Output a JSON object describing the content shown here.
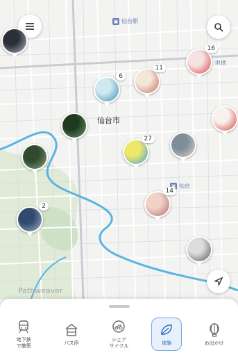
{
  "map": {
    "city_label": "仙台市",
    "watermark": "Pathweaver",
    "poi_top": "仙台駅",
    "poi_mid": "仙台",
    "poi_right": "IR他"
  },
  "pins": [
    {
      "id": "pin-a",
      "count": "6",
      "colors": [
        "#cfe7ef",
        "#3c8fb0"
      ]
    },
    {
      "id": "pin-b",
      "count": "11",
      "colors": [
        "#f2e7d8",
        "#c96a61"
      ]
    },
    {
      "id": "pin-c",
      "count": "16",
      "colors": [
        "#f4e3e0",
        "#d9424a"
      ]
    },
    {
      "id": "pin-d",
      "count": "27",
      "colors": [
        "#f0e76a",
        "#3aa4dc"
      ]
    },
    {
      "id": "pin-e",
      "count": "14",
      "colors": [
        "#f2d2c6",
        "#b06c72"
      ]
    },
    {
      "id": "pin-f",
      "count": "2",
      "colors": [
        "#324a6c",
        "#9ab3c9"
      ]
    },
    {
      "id": "pin-g",
      "count": "",
      "colors": [
        "#1f3a20",
        "#6e9564"
      ]
    },
    {
      "id": "pin-h",
      "count": "",
      "colors": [
        "#2f4a2d",
        "#86a07a"
      ]
    },
    {
      "id": "pin-i",
      "count": "",
      "colors": [
        "#f7f2ee",
        "#d6433e"
      ]
    },
    {
      "id": "pin-j",
      "count": "",
      "colors": [
        "#7f8d98",
        "#d8d5d0"
      ]
    },
    {
      "id": "pin-k",
      "count": "",
      "colors": [
        "#dcdcdc",
        "#5a5a5a"
      ]
    },
    {
      "id": "pin-l",
      "count": "",
      "colors": [
        "#2a2f38",
        "#a8b6c1"
      ]
    }
  ],
  "tabs": [
    {
      "label": "地下鉄\nで散策",
      "icon": "subway-icon"
    },
    {
      "label": "バス停",
      "icon": "bus-stop-icon"
    },
    {
      "label": "シェア\nサイクル",
      "icon": "bike-share-icon"
    },
    {
      "label": "体験",
      "icon": "experience-icon",
      "active": true
    },
    {
      "label": "お出かけ",
      "icon": "outing-icon"
    }
  ],
  "colors": {
    "accent": "#2f6fc4",
    "river": "#5ab3e1",
    "park": "#dfead7"
  }
}
